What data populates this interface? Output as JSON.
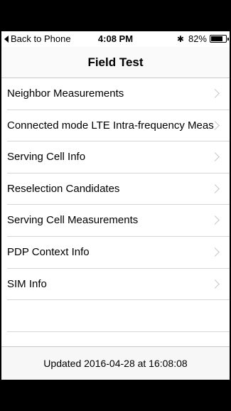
{
  "status_bar": {
    "back_label": "Back to Phone",
    "time": "4:08 PM",
    "battery_percent": "82%",
    "battery_level": 0.82,
    "bluetooth_icon": "bluetooth-icon"
  },
  "nav": {
    "title": "Field Test"
  },
  "rows": [
    {
      "label": "Neighbor Measurements"
    },
    {
      "label": "Connected mode LTE Intra-frequency Meas"
    },
    {
      "label": "Serving Cell Info"
    },
    {
      "label": "Reselection Candidates"
    },
    {
      "label": "Serving Cell Measurements"
    },
    {
      "label": "PDP Context Info"
    },
    {
      "label": "SIM Info"
    }
  ],
  "footer": {
    "updated": "Updated 2016-04-28 at 16:08:08"
  }
}
